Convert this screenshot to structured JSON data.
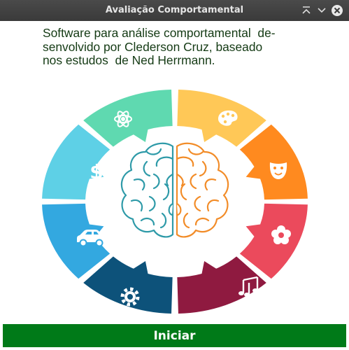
{
  "window": {
    "title": "Avaliação Comportamental",
    "controls": {
      "shade_icon": "chevron-up-icon",
      "minimize_icon": "chevron-down-icon",
      "close_icon": "close-icon"
    }
  },
  "description": {
    "lines": [
      "Software para análise comportamental  de-",
      "senvolvido por Clederson Cruz, baseado",
      "nos estudos  de Ned Herrmann."
    ]
  },
  "illustration": {
    "segments": [
      {
        "icon": "atom-icon",
        "color": "#5fd9b0"
      },
      {
        "icon": "palette-icon",
        "color": "#ffc857"
      },
      {
        "icon": "theater-mask-icon",
        "color": "#ff8a1f"
      },
      {
        "icon": "flower-icon",
        "color": "#eb4a5c"
      },
      {
        "icon": "music-notes-icon",
        "color": "#8f1a40"
      },
      {
        "icon": "gear-icon",
        "color": "#0d527a"
      },
      {
        "icon": "car-icon",
        "color": "#33a8e0"
      },
      {
        "icon": "dollar-icon",
        "color": "#5ed0e6"
      }
    ],
    "brain": {
      "left_color": "#2e9aa8",
      "right_color": "#f28c28",
      "icon": "brain-icon"
    }
  },
  "start_button": {
    "label": "Iniciar",
    "color": "#007a18"
  }
}
